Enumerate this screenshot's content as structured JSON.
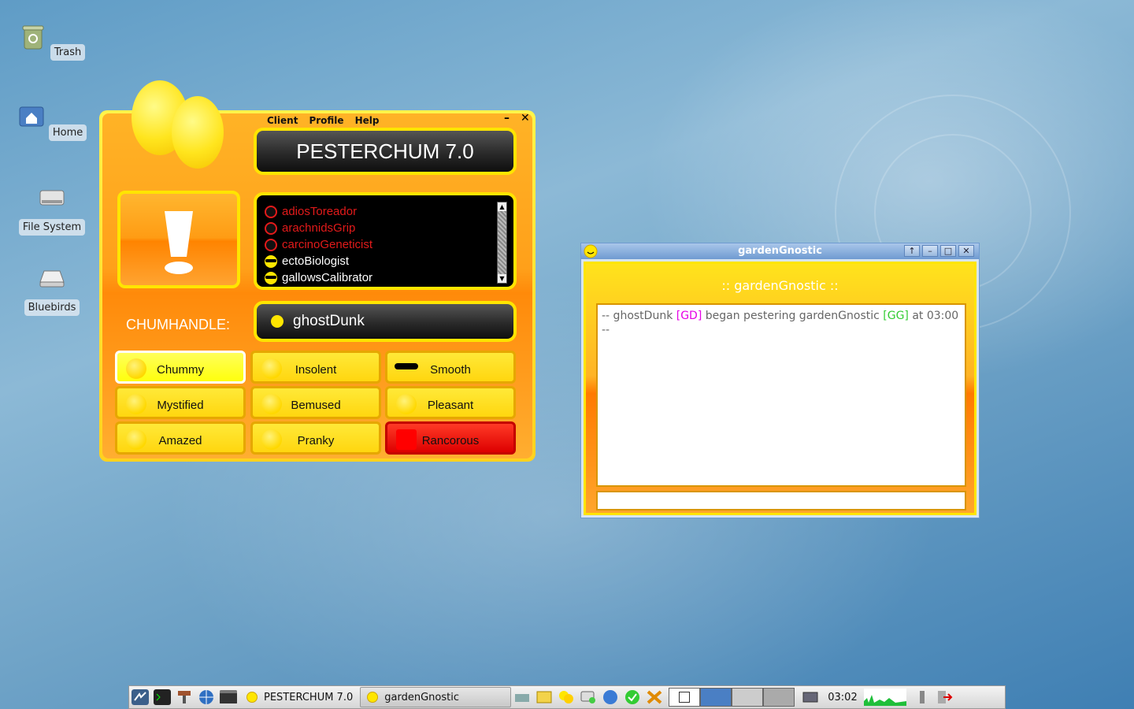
{
  "desktop": {
    "icons": [
      {
        "label": "Trash",
        "icon": "trash-icon"
      },
      {
        "label": "Home",
        "icon": "home-folder-icon"
      },
      {
        "label": "File System",
        "icon": "drive-icon"
      },
      {
        "label": "Bluebirds",
        "icon": "removable-drive-icon"
      }
    ]
  },
  "pesterchum": {
    "menu": [
      "Client",
      "Profile",
      "Help"
    ],
    "minimize_label": "–",
    "close_label": "✕",
    "title": "PESTERCHUM 7.0",
    "chums": [
      {
        "name": "adiosToreador",
        "status": "trollian",
        "color": "#e21a1a"
      },
      {
        "name": "arachnidsGrip",
        "status": "trollian",
        "color": "#e21a1a"
      },
      {
        "name": "carcinoGeneticist",
        "status": "trollian",
        "color": "#e21a1a"
      },
      {
        "name": "ectoBiologist",
        "status": "online",
        "color": "#ffffff"
      },
      {
        "name": "gallowsCalibrator",
        "status": "online",
        "color": "#ffffff"
      }
    ],
    "chumhandle_label": "CHUMHANDLE:",
    "chumhandle": "ghostDunk",
    "moods": [
      {
        "label": "Chummy",
        "selected": true
      },
      {
        "label": "Insolent"
      },
      {
        "label": "Smooth"
      },
      {
        "label": "Mystified"
      },
      {
        "label": "Bemused"
      },
      {
        "label": "Pleasant"
      },
      {
        "label": "Amazed"
      },
      {
        "label": "Pranky"
      },
      {
        "label": "Rancorous"
      }
    ]
  },
  "memo": {
    "window_title": "gardenGnostic",
    "header": ":: gardenGnostic ::",
    "log_line_prefix": "-- ghostDunk ",
    "log_tag_gd": "[GD]",
    "log_line_mid": " began pestering gardenGnostic ",
    "log_tag_gg": "[GG]",
    "log_line_suffix": " at 03:00",
    "log_line2": "--",
    "colors": {
      "gd": "#e600e6",
      "gg": "#33cc33"
    }
  },
  "taskbar": {
    "tasks": [
      "PESTERCHUM 7.0",
      "gardenGnostic"
    ],
    "clock": "03:02"
  }
}
